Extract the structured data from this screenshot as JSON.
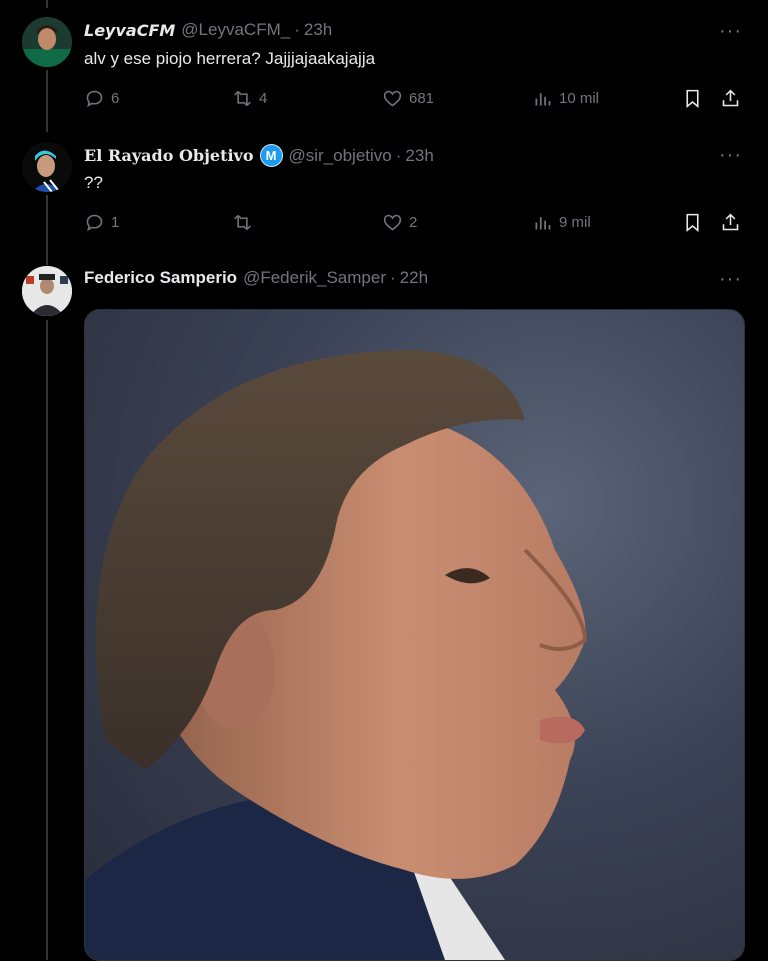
{
  "tweets": [
    {
      "name": "LeyvaCFM",
      "handle": "@LeyvaCFM_",
      "time": "23h",
      "text": "alv y ese piojo herrera? Jajjjajaakajajja",
      "replies": "6",
      "retweets": "4",
      "likes": "681",
      "views": "10 mil"
    },
    {
      "name": "El Rayado Objetivo",
      "badge": "M",
      "handle": "@sir_objetivo",
      "time": "23h",
      "text": "??",
      "replies": "1",
      "retweets": "",
      "likes": "2",
      "views": "9 mil"
    },
    {
      "name": "Federico Samperio",
      "handle": "@Federik_Samper",
      "time": "22h"
    }
  ],
  "more_glyph": "···",
  "colors": {
    "background": "#000000",
    "muted": "#71767b",
    "text": "#e7e9ea",
    "badge": "#1d9bf0"
  },
  "icons": [
    "reply-icon",
    "retweet-icon",
    "like-icon",
    "views-icon",
    "bookmark-icon",
    "share-icon",
    "more-icon",
    "verified-badge-icon"
  ]
}
